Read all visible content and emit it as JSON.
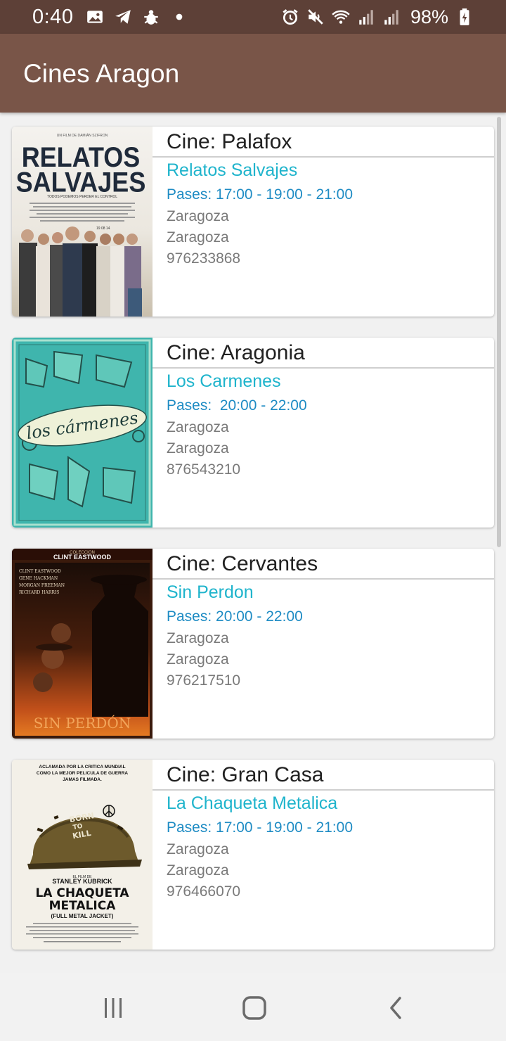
{
  "status_bar": {
    "time": "0:40",
    "battery": "98%",
    "left_icons": [
      "image-icon",
      "telegram-icon",
      "bug-icon",
      "dot-icon"
    ],
    "right_icons": [
      "alarm-icon",
      "mute-icon",
      "wifi-icon",
      "signal-icon",
      "signal-icon",
      "battery-charging-icon"
    ]
  },
  "app_bar": {
    "title": "Cines Aragon"
  },
  "cinemas": [
    {
      "cine": "Cine: Palafox",
      "movie": "Relatos Salvajes",
      "pases": "Pases: 17:00 - 19:00 - 21:00",
      "city": "Zaragoza",
      "province": "Zaragoza",
      "phone": "976233868",
      "poster": {
        "top_credit": "UN FILM DE DAMIÁN SZIFRON",
        "title_line1": "RELATOS",
        "title_line2": "SALVAJES",
        "tagline": "TODOS PODEMOS PERDER EL CONTROL",
        "date": "19 08 14"
      }
    },
    {
      "cine": "Cine: Aragonia",
      "movie": "Los Carmenes",
      "pases": "Pases:  20:00 - 22:00",
      "city": "Zaragoza",
      "province": "Zaragoza",
      "phone": "876543210",
      "poster": {
        "title": "los cármenes"
      }
    },
    {
      "cine": "Cine: Cervantes",
      "movie": "Sin Perdon",
      "pases": "Pases: 20:00 - 22:00",
      "city": "Zaragoza",
      "province": "Zaragoza",
      "phone": "976217510",
      "poster": {
        "collection_label": "COLECCION",
        "collection_name": "CLINT EASTWOOD",
        "cast": [
          "CLINT EASTWOOD",
          "GENE HACKMAN",
          "MORGAN FREEMAN",
          "RICHARD HARRIS"
        ],
        "title": "SIN PERDÓN"
      }
    },
    {
      "cine": "Cine: Gran Casa",
      "movie": "La Chaqueta Metalica",
      "pases": "Pases: 17:00 - 19:00 - 21:00",
      "city": "Zaragoza",
      "province": "Zaragoza",
      "phone": "976466070",
      "poster": {
        "quote": [
          "ACLAMADA POR LA CRITICA MUNDIAL",
          "COMO LA MEJOR PELICULA DE GUERRA",
          "JAMAS FILMADA."
        ],
        "helmet_text": [
          "BORN",
          "TO",
          "KILL"
        ],
        "director_label": "EL FILM DE",
        "director": "STANLEY KUBRICK",
        "title_line1": "LA CHAQUETA",
        "title_line2": "METALICA",
        "subtitle": "(FULL METAL JACKET)"
      }
    }
  ],
  "nav_bar": {
    "buttons": [
      "recents-icon",
      "home-icon",
      "back-icon"
    ]
  }
}
